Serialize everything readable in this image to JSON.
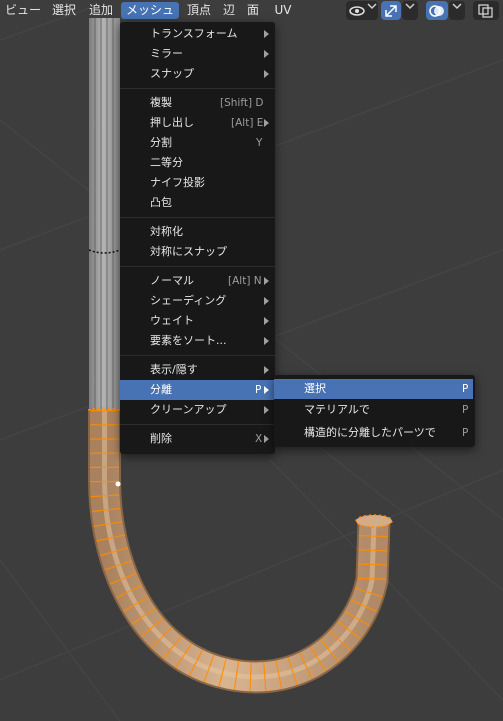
{
  "header": {
    "menus": [
      {
        "label": "ビュー"
      },
      {
        "label": "選択"
      },
      {
        "label": "追加"
      },
      {
        "label": "メッシュ"
      },
      {
        "label": "頂点"
      },
      {
        "label": "辺"
      },
      {
        "label": "面"
      },
      {
        "label": "UV"
      }
    ],
    "icons": [
      "eye-icon",
      "chevron-down-icon",
      "transform-gizmo-icon",
      "chevron-down-icon",
      "overlay-icon",
      "chevron-down-icon",
      "xray-icon"
    ]
  },
  "mesh_menu": {
    "items": [
      {
        "label": "トランスフォーム",
        "shortcut": "",
        "submenu": true
      },
      {
        "label": "ミラー",
        "shortcut": "",
        "submenu": true
      },
      {
        "label": "スナップ",
        "shortcut": "",
        "submenu": true
      },
      {
        "label": "複製",
        "shortcut": "[Shift] D",
        "submenu": false
      },
      {
        "label": "押し出し",
        "shortcut": "[Alt] E",
        "submenu": true
      },
      {
        "label": "分割",
        "shortcut": "Y",
        "submenu": false
      },
      {
        "label": "二等分",
        "shortcut": "",
        "submenu": false
      },
      {
        "label": "ナイフ投影",
        "shortcut": "",
        "submenu": false
      },
      {
        "label": "凸包",
        "shortcut": "",
        "submenu": false
      },
      {
        "label": "対称化",
        "shortcut": "",
        "submenu": false
      },
      {
        "label": "対称にスナップ",
        "shortcut": "",
        "submenu": false
      },
      {
        "label": "ノーマル",
        "shortcut": "[Alt] N",
        "submenu": true
      },
      {
        "label": "シェーディング",
        "shortcut": "",
        "submenu": true
      },
      {
        "label": "ウェイト",
        "shortcut": "",
        "submenu": true
      },
      {
        "label": "要素をソート...",
        "shortcut": "",
        "submenu": true
      },
      {
        "label": "表示/隠す",
        "shortcut": "",
        "submenu": true
      },
      {
        "label": "分離",
        "shortcut": "P",
        "submenu": true,
        "highlighted": true
      },
      {
        "label": "クリーンアップ",
        "shortcut": "",
        "submenu": true
      },
      {
        "label": "削除",
        "shortcut": "X",
        "submenu": true
      }
    ]
  },
  "separate_submenu": {
    "items": [
      {
        "label": "選択",
        "shortcut": "P",
        "highlighted": true
      },
      {
        "label": "マテリアルで",
        "shortcut": "P"
      },
      {
        "label": "構造的に分離したパーツで",
        "shortcut": "P"
      }
    ]
  },
  "colors": {
    "accent": "#4772b3",
    "menu_bg": "#181818",
    "viewport_bg": "#3d3d3d",
    "mesh_selected": "#c9a17a",
    "vertex_selected": "#ff8c00",
    "mesh_unselected": "#9c9c9c"
  }
}
